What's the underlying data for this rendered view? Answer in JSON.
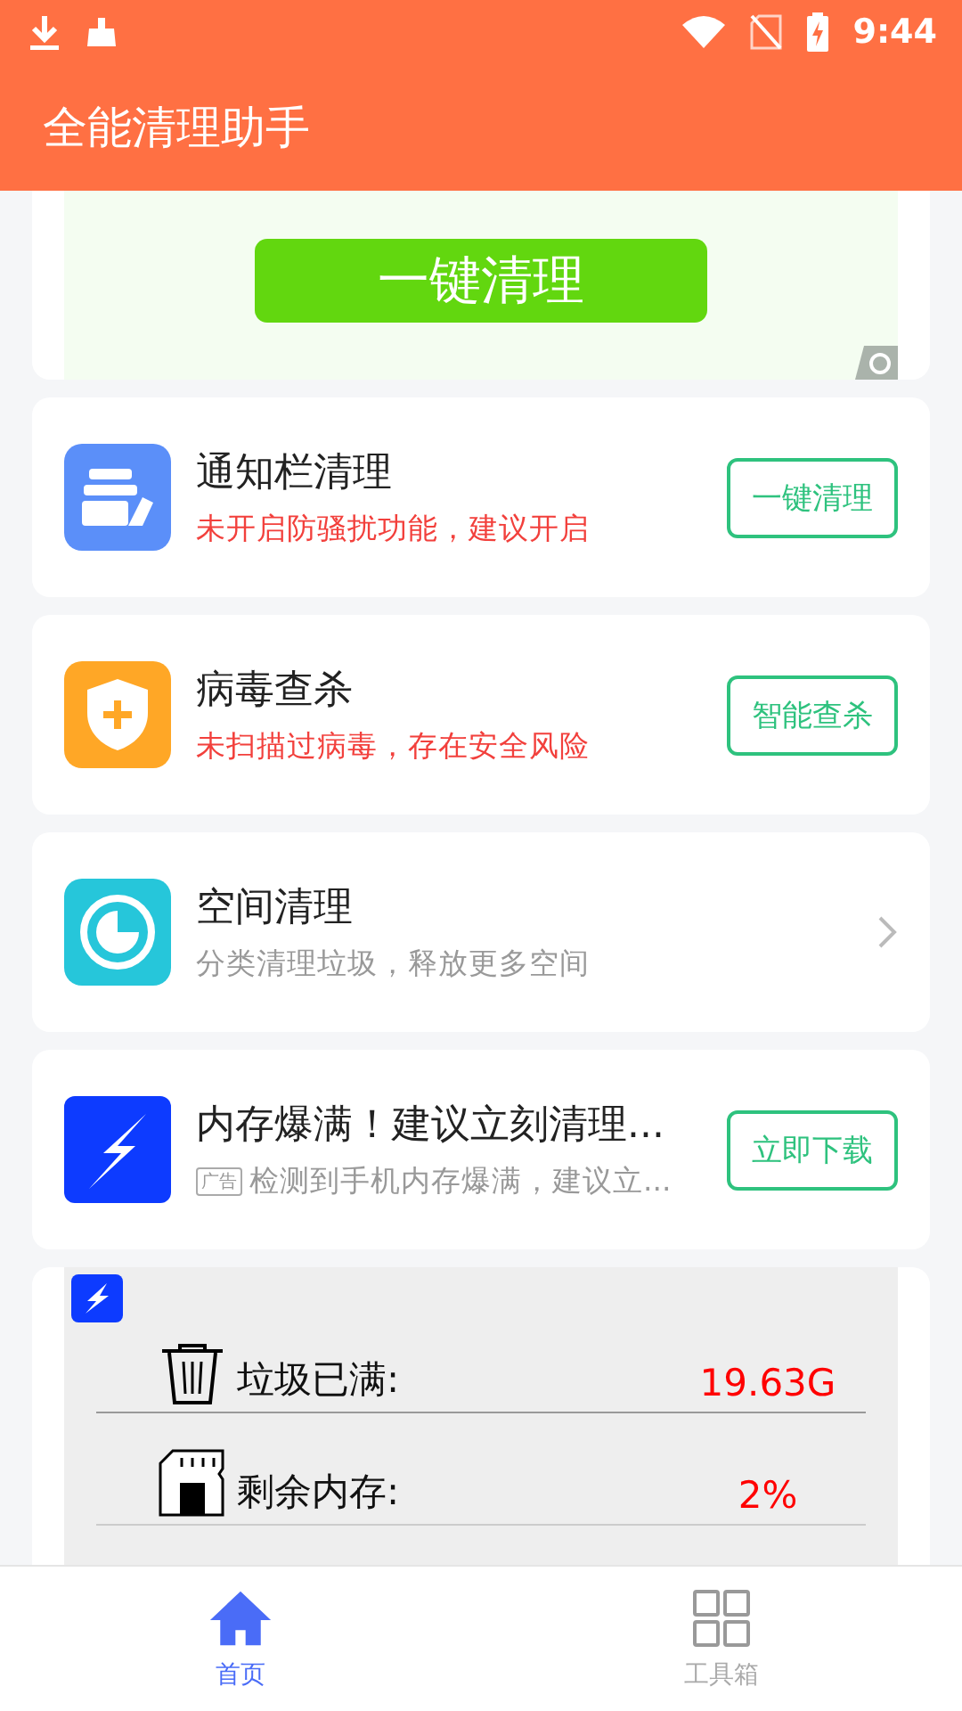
{
  "status_bar": {
    "time": "9:44"
  },
  "app_bar": {
    "title": "全能清理助手"
  },
  "banner": {
    "button": "一键清理"
  },
  "cards": [
    {
      "kind": "action",
      "title": "通知栏清理",
      "subtitle": "未开启防骚扰功能，建议开启",
      "alert": true,
      "button": "一键清理"
    },
    {
      "kind": "action",
      "title": "病毒查杀",
      "subtitle": "未扫描过病毒，存在安全风险",
      "alert": true,
      "button": "智能查杀"
    },
    {
      "kind": "link",
      "title": "空间清理",
      "subtitle": "分类清理垃圾，释放更多空间",
      "alert": false
    }
  ],
  "ad": {
    "title": "内存爆满！建议立刻清理...",
    "tag": "广告",
    "subtitle": "检测到手机内存爆满，建议立...",
    "button": "立即下载"
  },
  "stats": [
    {
      "label": "垃圾已满:",
      "value": "19.63G"
    },
    {
      "label": "剩余内存:",
      "value": "2%"
    }
  ],
  "nav": [
    {
      "label": "首页",
      "selected": true
    },
    {
      "label": "工具箱",
      "selected": false
    }
  ]
}
